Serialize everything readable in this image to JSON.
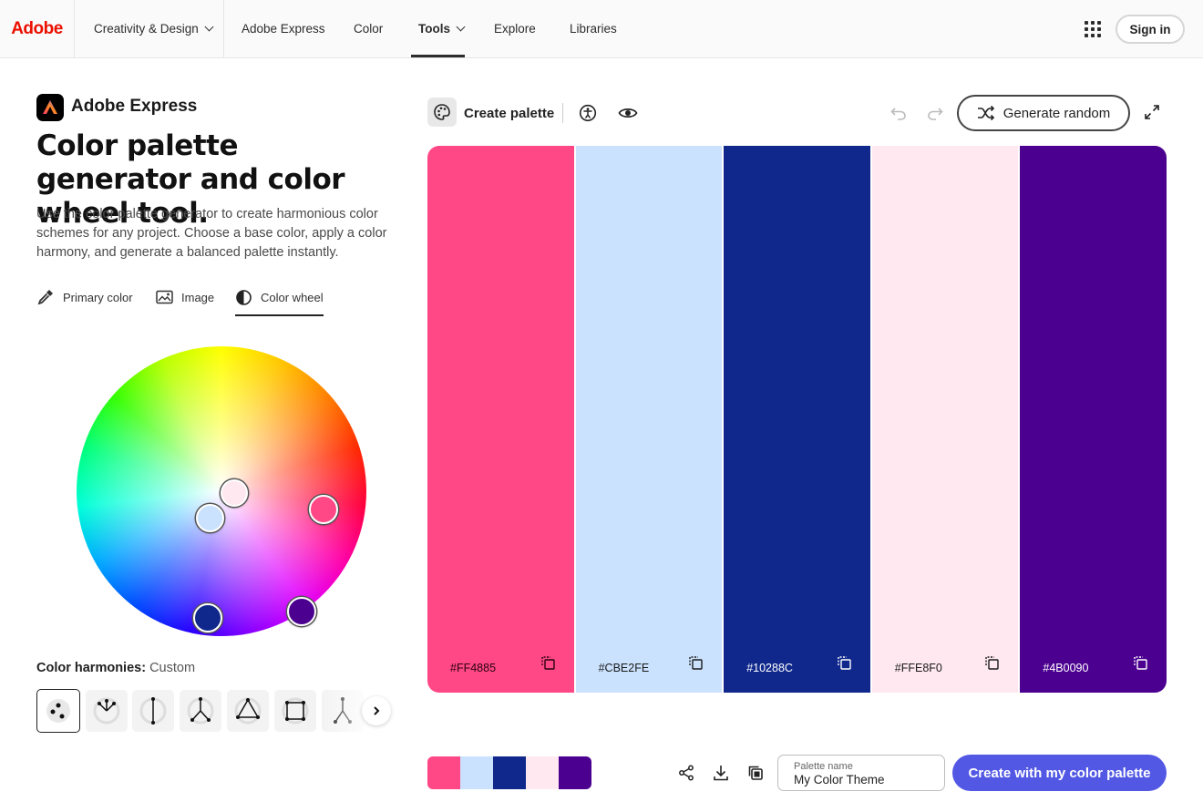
{
  "nav": {
    "brand": "Adobe",
    "items": [
      {
        "label": "Creativity & Design",
        "dropdown": true
      },
      {
        "label": "Adobe Express",
        "dropdown": false
      },
      {
        "label": "Color",
        "dropdown": false
      },
      {
        "label": "Tools",
        "dropdown": true,
        "active": true
      },
      {
        "label": "Explore",
        "dropdown": false
      },
      {
        "label": "Libraries",
        "dropdown": false
      }
    ],
    "apps_icon": "app-grid-icon",
    "sign_in": "Sign in"
  },
  "hero": {
    "product": "Adobe Express",
    "title": "Color palette generator and color wheel tool.",
    "description": "Use the color palette generator to create harmonious color schemes for any project. Choose a base color, apply a color harmony, and generate a balanced palette instantly."
  },
  "source_tabs": [
    {
      "label": "Primary color",
      "icon": "eyedropper-icon"
    },
    {
      "label": "Image",
      "icon": "image-icon"
    },
    {
      "label": "Color wheel",
      "icon": "color-wheel-icon",
      "active": true
    }
  ],
  "harmonies": {
    "label": "Color harmonies:",
    "value": "Custom",
    "options": [
      "custom",
      "analogous",
      "complementary",
      "split-complementary",
      "triad",
      "square",
      "compound"
    ]
  },
  "toolbar": {
    "create_palette": "Create palette",
    "generate_random": "Generate random"
  },
  "palette": {
    "colors": [
      {
        "hex": "#FF4885",
        "text": "#2a0010"
      },
      {
        "hex": "#CBE2FE",
        "text": "#1a1a1a"
      },
      {
        "hex": "#10288C",
        "text": "#ffffff"
      },
      {
        "hex": "#FFE8F0",
        "text": "#1a1a1a"
      },
      {
        "hex": "#4B0090",
        "text": "#ffffff"
      }
    ]
  },
  "footer": {
    "palette_name_label": "Palette name",
    "palette_name_value": "My Color Theme",
    "create_button": "Create with my color palette"
  }
}
